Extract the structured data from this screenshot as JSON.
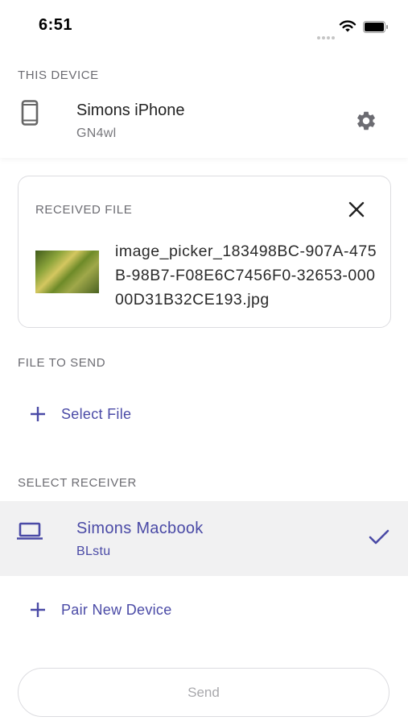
{
  "status_bar": {
    "time": "6:51"
  },
  "this_device": {
    "section_label": "THIS DEVICE",
    "name": "Simons iPhone",
    "code": "GN4wl",
    "icon": "smartphone-icon",
    "settings_icon": "gear-icon"
  },
  "received_file": {
    "section_label": "RECEIVED FILE",
    "close_icon": "close-icon",
    "file_name": "image_picker_183498BC-907A-475B-98B7-F08E6C7456F0-32653-00000D31B32CE193.jpg"
  },
  "file_to_send": {
    "section_label": "FILE TO SEND",
    "select_label": "Select File"
  },
  "select_receiver": {
    "section_label": "SELECT RECEIVER",
    "receivers": [
      {
        "name": "Simons Macbook",
        "code": "BLstu",
        "icon": "laptop-icon",
        "selected": true
      }
    ],
    "pair_label": "Pair New Device"
  },
  "send_button": {
    "label": "Send"
  },
  "colors": {
    "accent": "#4a4aa6",
    "selected_row": "#f1f1f2",
    "muted": "#6c6c72"
  }
}
